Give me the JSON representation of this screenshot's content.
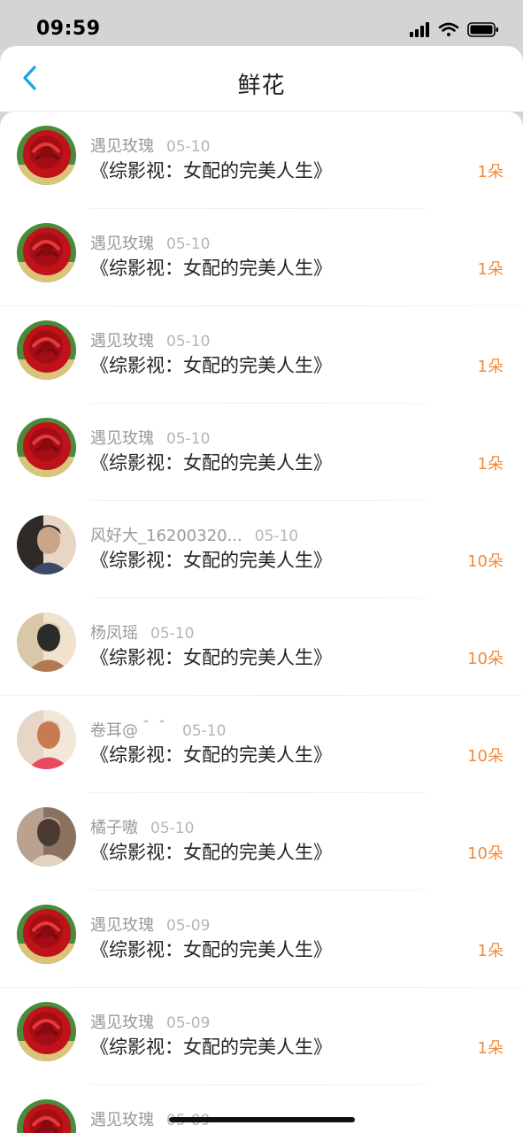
{
  "status_bar": {
    "time": "09:59"
  },
  "header": {
    "title": "鲜花"
  },
  "records": [
    {
      "name": "遇见玫瑰",
      "date": "05-10",
      "book": "《综影视：女配的完美人生》",
      "count": "1朵",
      "avatar": "rose"
    },
    {
      "name": "遇见玫瑰",
      "date": "05-10",
      "book": "《综影视：女配的完美人生》",
      "count": "1朵",
      "avatar": "rose"
    },
    {
      "name": "遇见玫瑰",
      "date": "05-10",
      "book": "《综影视：女配的完美人生》",
      "count": "1朵",
      "avatar": "rose"
    },
    {
      "name": "遇见玫瑰",
      "date": "05-10",
      "book": "《综影视：女配的完美人生》",
      "count": "1朵",
      "avatar": "rose"
    },
    {
      "name": "风好大_16200320...",
      "date": "05-10",
      "book": "《综影视：女配的完美人生》",
      "count": "10朵",
      "avatar": "portrait-a"
    },
    {
      "name": "杨凤瑶",
      "date": "05-10",
      "book": "《综影视：女配的完美人生》",
      "count": "10朵",
      "avatar": "portrait-b"
    },
    {
      "name": "卷耳@＾＾",
      "date": "05-10",
      "book": "《综影视：女配的完美人生》",
      "count": "10朵",
      "avatar": "portrait-c"
    },
    {
      "name": "橘子嗷",
      "date": "05-10",
      "book": "《综影视：女配的完美人生》",
      "count": "10朵",
      "avatar": "portrait-d"
    },
    {
      "name": "遇见玫瑰",
      "date": "05-09",
      "book": "《综影视：女配的完美人生》",
      "count": "1朵",
      "avatar": "rose"
    },
    {
      "name": "遇见玫瑰",
      "date": "05-09",
      "book": "《综影视：女配的完美人生》",
      "count": "1朵",
      "avatar": "rose"
    },
    {
      "name": "遇见玫瑰",
      "date": "05-09",
      "book": "",
      "count": "",
      "avatar": "rose"
    }
  ]
}
